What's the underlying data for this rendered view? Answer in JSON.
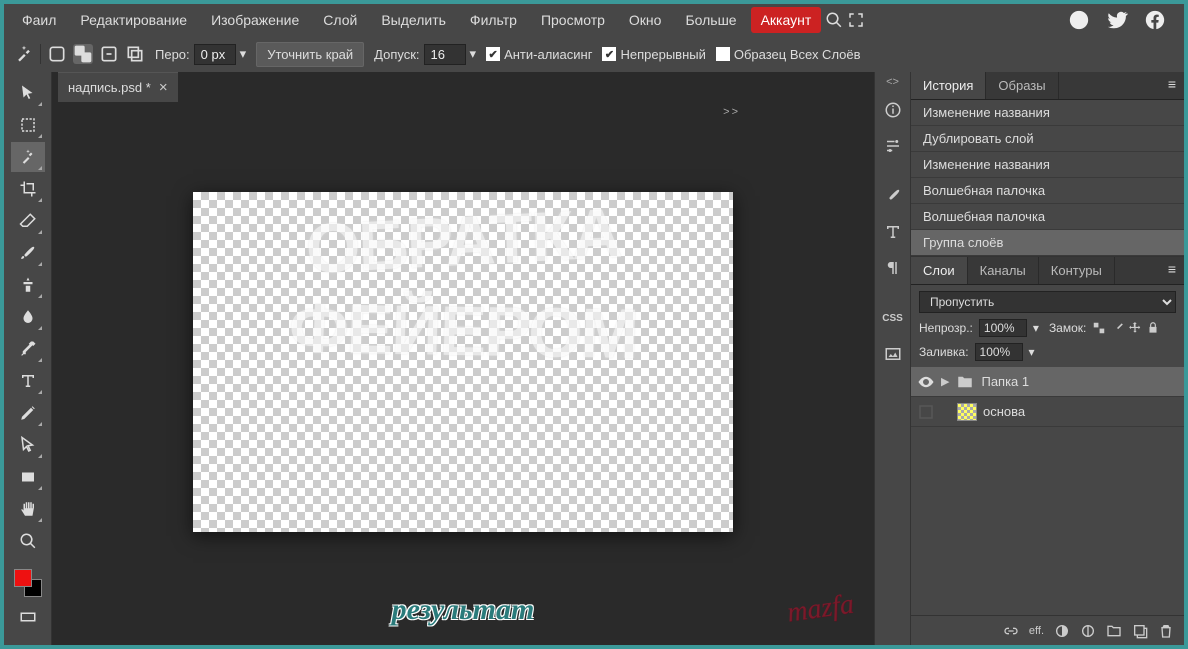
{
  "menu": {
    "items": [
      "Фаил",
      "Редактирование",
      "Изображение",
      "Слой",
      "Выделить",
      "Фильтр",
      "Просмотр",
      "Окно",
      "Больше"
    ],
    "account": "Аккаунт"
  },
  "optbar": {
    "feather_label": "Перо:",
    "feather_value": "0 px",
    "refine": "Уточнить край",
    "tolerance_label": "Допуск:",
    "tolerance_value": "16",
    "antialias": "Анти-алиасинг",
    "contiguous": "Непрерывный",
    "sample_all": "Образец Всех Слоёв"
  },
  "doc": {
    "tab": "надпись.psd *"
  },
  "canvas": {
    "text_line1": "ОБРАТКА",
    "text_line2": "ФЕЙЕРОМ"
  },
  "result": "результат",
  "history": {
    "tabs": [
      "История",
      "Образы"
    ],
    "items": [
      "Изменение названия",
      "Дублировать слой",
      "Изменение названия",
      "Волшебная палочка",
      "Волшебная палочка",
      "Группа слоёв"
    ]
  },
  "layers": {
    "tabs": [
      "Слои",
      "Каналы",
      "Контуры"
    ],
    "blend": "Пропустить",
    "opacity_label": "Непрозр.:",
    "opacity_value": "100%",
    "lock_label": "Замок:",
    "fill_label": "Заливка:",
    "fill_value": "100%",
    "items": [
      {
        "name": "Папка 1",
        "type": "folder",
        "visible": true,
        "selected": true
      },
      {
        "name": "основа",
        "type": "layer",
        "visible": false,
        "selected": false
      }
    ]
  },
  "side_labels": {
    "css": "CSS",
    "eff": "eff."
  },
  "signature": "mazfa"
}
